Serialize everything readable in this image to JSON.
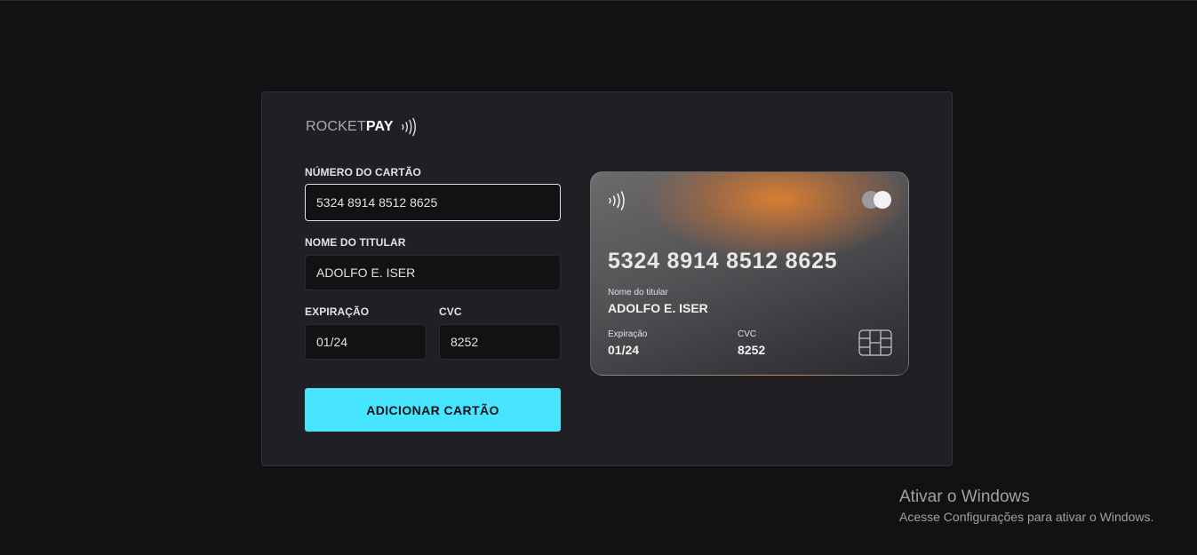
{
  "brand": {
    "rocket": "ROCKET",
    "pay": "PAY"
  },
  "form": {
    "number_label": "NÚMERO DO CARTÃO",
    "number_value": "5324 8914 8512 8625",
    "holder_label": "NOME DO TITULAR",
    "holder_value": "ADOLFO E. ISER",
    "exp_label": "EXPIRAÇÃO",
    "exp_value": "01/24",
    "cvc_label": "CVC",
    "cvc_value": "8252",
    "submit_label": "ADICIONAR CARTÃO"
  },
  "card": {
    "number": "5324 8914 8512 8625",
    "holder_label": "Nome do titular",
    "holder": "ADOLFO E. ISER",
    "exp_label": "Expiração",
    "exp": "01/24",
    "cvc_label": "CVC",
    "cvc": "8252"
  },
  "watermark": {
    "title": "Ativar o Windows",
    "subtitle": "Acesse Configurações para ativar o Windows."
  },
  "colors": {
    "background": "#121214",
    "panel": "#202024",
    "input": "#121214",
    "accent": "#47e4ff"
  },
  "icons": [
    "contactless-icon",
    "card-brand-icon",
    "chip-icon"
  ]
}
